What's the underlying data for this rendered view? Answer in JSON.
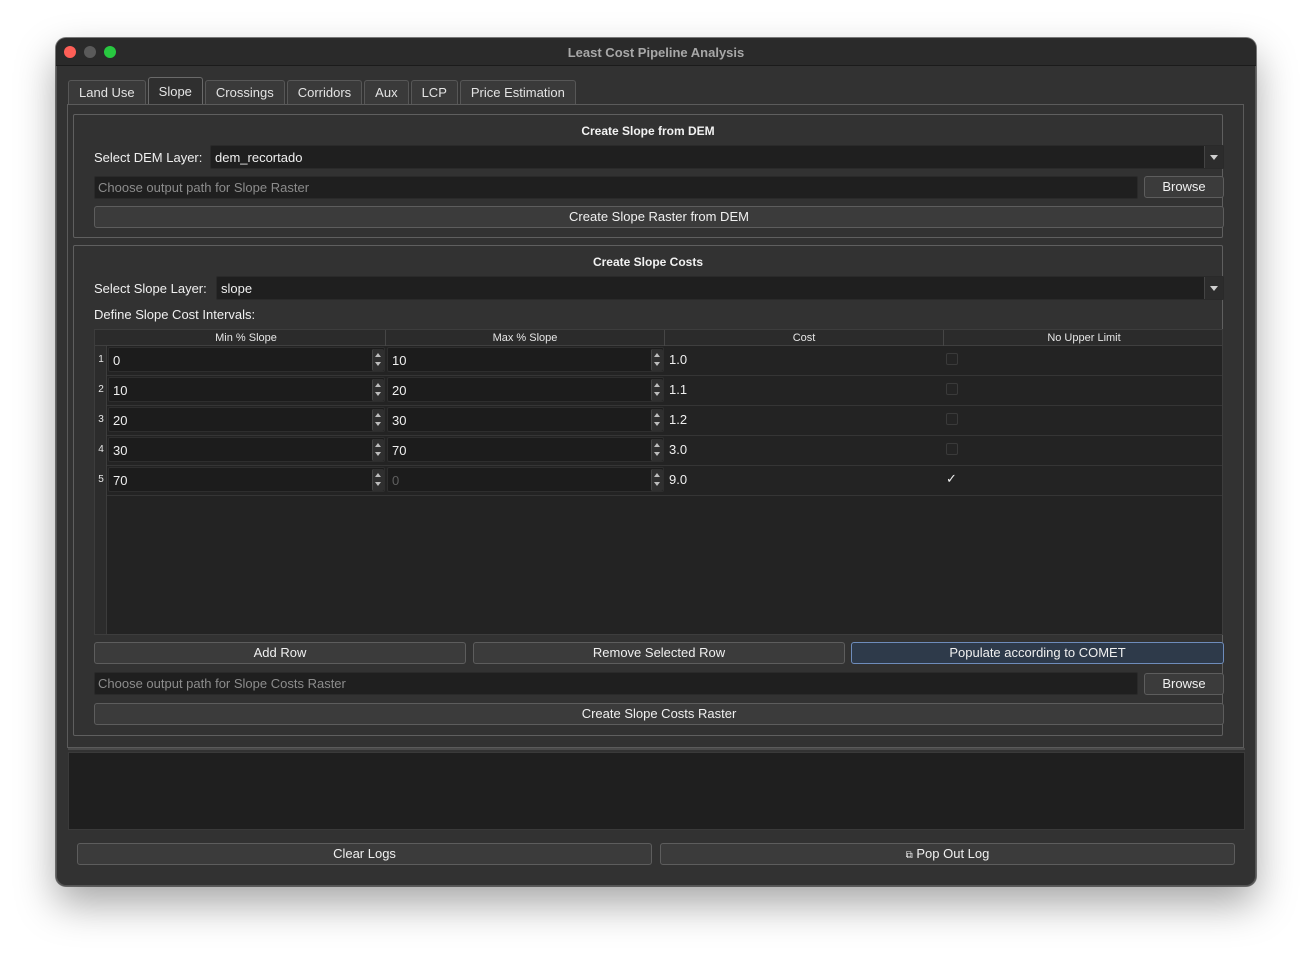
{
  "window": {
    "title": "Least Cost Pipeline Analysis"
  },
  "tabs": [
    {
      "label": "Land Use"
    },
    {
      "label": "Slope",
      "active": true
    },
    {
      "label": "Crossings"
    },
    {
      "label": "Corridors"
    },
    {
      "label": "Aux"
    },
    {
      "label": "LCP"
    },
    {
      "label": "Price Estimation"
    }
  ],
  "dem_group": {
    "title": "Create Slope from DEM",
    "layer_label": "Select DEM Layer:",
    "layer_value": "dem_recortado",
    "output_placeholder": "Choose output path for Slope Raster",
    "browse_label": "Browse",
    "create_label": "Create Slope Raster from DEM"
  },
  "cost_group": {
    "title": "Create Slope Costs",
    "layer_label": "Select Slope Layer:",
    "layer_value": "slope",
    "intervals_label": "Define Slope Cost Intervals:",
    "columns": [
      "Min % Slope",
      "Max % Slope",
      "Cost",
      "No Upper Limit"
    ],
    "rows": [
      {
        "num": "1",
        "min": "0",
        "max": "10",
        "cost": "1.0",
        "no_upper": false
      },
      {
        "num": "2",
        "min": "10",
        "max": "20",
        "cost": "1.1",
        "no_upper": false
      },
      {
        "num": "3",
        "min": "20",
        "max": "30",
        "cost": "1.2",
        "no_upper": false
      },
      {
        "num": "4",
        "min": "30",
        "max": "70",
        "cost": "3.0",
        "no_upper": false
      },
      {
        "num": "5",
        "min": "70",
        "max": "0",
        "cost": "9.0",
        "no_upper": true
      }
    ],
    "checkmark": "✓",
    "add_row_label": "Add Row",
    "remove_row_label": "Remove Selected Row",
    "populate_label": "Populate according to COMET",
    "output_placeholder": "Choose output path for Slope Costs Raster",
    "browse_label": "Browse",
    "create_label": "Create Slope Costs Raster"
  },
  "footer": {
    "clear_logs_label": "Clear Logs",
    "pop_out_icon": "⧉",
    "pop_out_label": "Pop Out Log"
  },
  "colors": {
    "window_bg": "#323232",
    "field_bg": "#1f1f1f",
    "accent_border": "#6e8cbb",
    "close": "#fe5f57",
    "maximize": "#28c840"
  }
}
